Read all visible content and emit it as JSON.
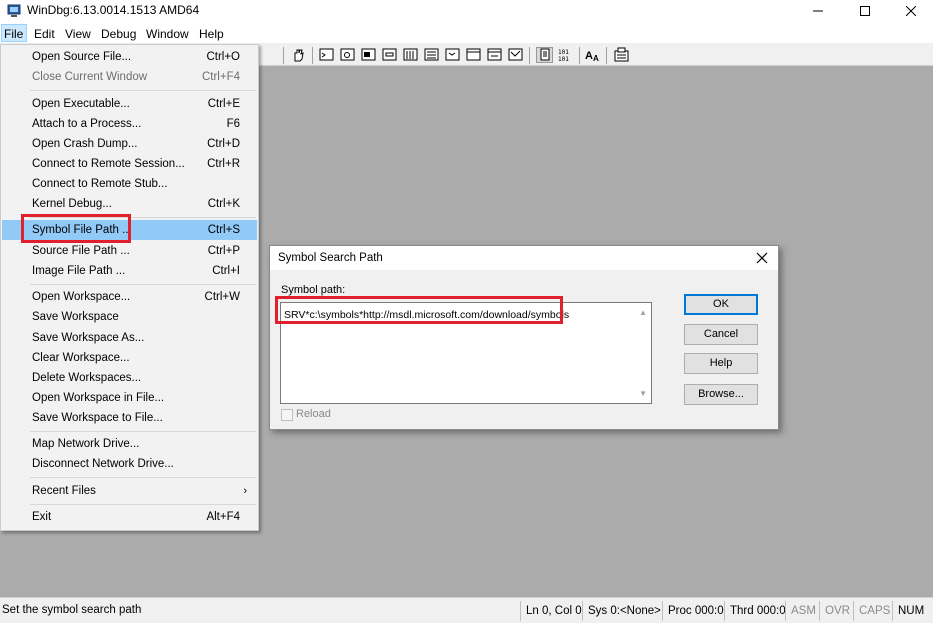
{
  "window": {
    "title": "WinDbg:6.13.0014.1513 AMD64"
  },
  "menubar": {
    "items": [
      "File",
      "Edit",
      "View",
      "Debug",
      "Window",
      "Help"
    ]
  },
  "file_menu": {
    "items": [
      {
        "label": "Open Source File...",
        "accel": "Ctrl+O"
      },
      {
        "label": "Close Current Window",
        "accel": "Ctrl+F4"
      },
      {
        "label": "Open Executable...",
        "accel": "Ctrl+E"
      },
      {
        "label": "Attach to a Process...",
        "accel": "F6"
      },
      {
        "label": "Open Crash Dump...",
        "accel": "Ctrl+D"
      },
      {
        "label": "Connect to Remote Session...",
        "accel": "Ctrl+R"
      },
      {
        "label": "Connect to Remote Stub...",
        "accel": ""
      },
      {
        "label": "Kernel Debug...",
        "accel": "Ctrl+K"
      },
      {
        "label": "Symbol File Path ...",
        "accel": "Ctrl+S"
      },
      {
        "label": "Source File Path ...",
        "accel": "Ctrl+P"
      },
      {
        "label": "Image File Path ...",
        "accel": "Ctrl+I"
      },
      {
        "label": "Open Workspace...",
        "accel": "Ctrl+W"
      },
      {
        "label": "Save Workspace",
        "accel": ""
      },
      {
        "label": "Save Workspace As...",
        "accel": ""
      },
      {
        "label": "Clear Workspace...",
        "accel": ""
      },
      {
        "label": "Delete Workspaces...",
        "accel": ""
      },
      {
        "label": "Open Workspace in File...",
        "accel": ""
      },
      {
        "label": "Save Workspace to File...",
        "accel": ""
      },
      {
        "label": "Map Network Drive...",
        "accel": ""
      },
      {
        "label": "Disconnect Network Drive...",
        "accel": ""
      },
      {
        "label": "Recent Files",
        "accel": ""
      },
      {
        "label": "Exit",
        "accel": "Alt+F4"
      }
    ]
  },
  "dialog": {
    "title": "Symbol Search Path",
    "label": "Symbol path:",
    "path_value": "SRV*c:\\symbols*http://msdl.microsoft.com/download/symbols",
    "reload_label": "Reload",
    "ok_label": "OK",
    "cancel_label": "Cancel",
    "help_label": "Help",
    "browse_label": "Browse..."
  },
  "statusbar": {
    "message": "Set the symbol search path",
    "cells": [
      "Ln 0, Col 0",
      "Sys 0:<None>",
      "Proc 000:0",
      "Thrd 000:0",
      "ASM",
      "OVR",
      "CAPS",
      "NUM"
    ]
  },
  "colors": {
    "highlight": "#91c9f7",
    "annotation_red": "#e0202a",
    "default_button_border": "#0078d7",
    "client_background": "#ababab"
  }
}
